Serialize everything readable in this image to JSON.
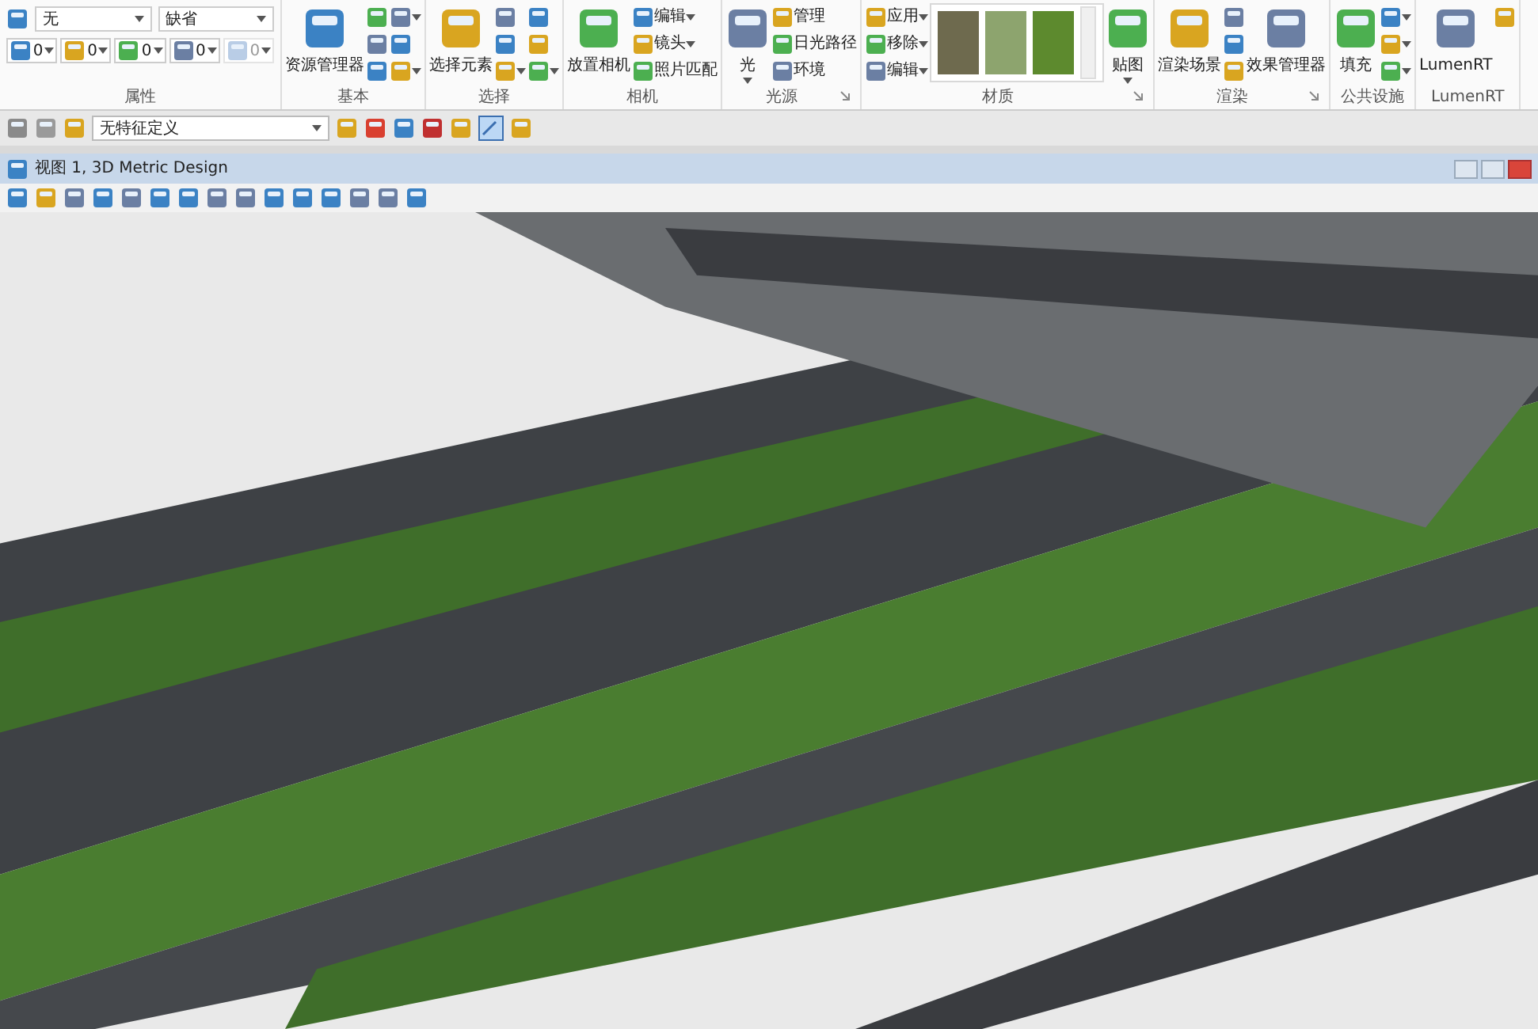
{
  "ribbon": {
    "properties": {
      "label": "属性",
      "dropdowns": [
        {
          "value": "无"
        },
        {
          "value": "缺省"
        }
      ],
      "small_dropdowns": [
        {
          "value": "0",
          "disabled": false
        },
        {
          "value": "0",
          "disabled": false
        },
        {
          "value": "0",
          "disabled": false
        },
        {
          "value": "0",
          "disabled": false
        },
        {
          "value": "0",
          "disabled": true
        }
      ]
    },
    "groups": [
      {
        "label": "基本",
        "launcher": false,
        "columns": [
          [
            {
              "kind": "large",
              "label": "资源管理器",
              "caret": false
            }
          ],
          [
            {
              "kind": "small",
              "caret": false
            },
            {
              "kind": "small",
              "caret": false
            },
            {
              "kind": "small",
              "caret": false
            }
          ],
          [
            {
              "kind": "small",
              "caret": true
            },
            {
              "kind": "small",
              "caret": false
            },
            {
              "kind": "small",
              "caret": true
            }
          ]
        ]
      },
      {
        "label": "选择",
        "launcher": false,
        "columns": [
          [
            {
              "kind": "large",
              "label": "选择元素",
              "caret": false
            }
          ],
          [
            {
              "kind": "small",
              "caret": false
            },
            {
              "kind": "small",
              "caret": false
            },
            {
              "kind": "small",
              "caret": true
            }
          ],
          [
            {
              "kind": "small",
              "caret": false
            },
            {
              "kind": "small",
              "caret": false
            },
            {
              "kind": "small",
              "caret": true
            }
          ]
        ]
      },
      {
        "label": "相机",
        "launcher": false,
        "columns": [
          [
            {
              "kind": "large",
              "label": "放置相机",
              "caret": false
            }
          ],
          [
            {
              "kind": "small",
              "label": "编辑",
              "caret": true
            },
            {
              "kind": "small",
              "label": "镜头",
              "caret": true
            },
            {
              "kind": "small",
              "label": "照片匹配",
              "caret": false
            }
          ]
        ]
      },
      {
        "label": "光源",
        "launcher": true,
        "columns": [
          [
            {
              "kind": "large",
              "label": "光",
              "caret": true
            }
          ],
          [
            {
              "kind": "small",
              "label": "管理",
              "caret": false
            },
            {
              "kind": "small",
              "label": "日光路径",
              "caret": false
            },
            {
              "kind": "small",
              "label": "环境",
              "caret": false
            }
          ]
        ]
      },
      {
        "label": "材质",
        "launcher": true,
        "columns": [
          [
            {
              "kind": "small",
              "label": "应用",
              "caret": true
            },
            {
              "kind": "small",
              "label": "移除",
              "caret": true
            },
            {
              "kind": "small",
              "label": "编辑",
              "caret": true
            }
          ],
          [
            {
              "kind": "gallery"
            }
          ],
          [
            {
              "kind": "large",
              "label": "贴图",
              "caret": true
            }
          ]
        ]
      },
      {
        "label": "渲染",
        "launcher": true,
        "columns": [
          [
            {
              "kind": "large",
              "label": "渲染场景",
              "caret": false
            }
          ],
          [
            {
              "kind": "small",
              "caret": false
            },
            {
              "kind": "small",
              "caret": false
            },
            {
              "kind": "small",
              "caret": false
            }
          ],
          [
            {
              "kind": "large",
              "label": "效果管理器",
              "caret": false
            }
          ]
        ]
      },
      {
        "label": "公共设施",
        "launcher": false,
        "columns": [
          [
            {
              "kind": "large",
              "label": "填充",
              "caret": false
            }
          ],
          [
            {
              "kind": "small",
              "caret": true
            },
            {
              "kind": "small",
              "caret": true
            },
            {
              "kind": "small",
              "caret": true
            }
          ]
        ]
      },
      {
        "label": "LumenRT",
        "launcher": false,
        "columns": [
          [
            {
              "kind": "large",
              "label": "LumenRT",
              "caret": false
            }
          ],
          [
            {
              "kind": "small",
              "caret": false
            }
          ]
        ]
      }
    ]
  },
  "toolbar": {
    "feature_dropdown": {
      "value": "无特征定义"
    },
    "snap_toggle": {
      "selected": true
    }
  },
  "view": {
    "title": "视图 1, 3D Metric Design"
  }
}
